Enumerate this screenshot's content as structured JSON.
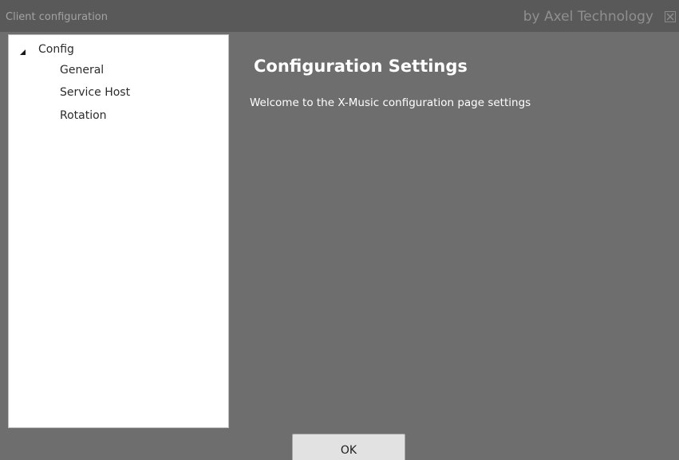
{
  "window": {
    "title": "Client configuration",
    "brand": "by Axel Technology",
    "close_icon": "close-icon"
  },
  "tree": {
    "root": {
      "label": "Config",
      "expanded": true,
      "expander_icon": "triangle-expanded-icon"
    },
    "children": [
      {
        "label": "General"
      },
      {
        "label": "Service Host"
      },
      {
        "label": "Rotation"
      }
    ]
  },
  "content": {
    "title": "Configuration Settings",
    "description": "Welcome to the X-Music configuration page settings"
  },
  "footer": {
    "ok_label": "OK"
  },
  "colors": {
    "titlebar": "#595959",
    "background": "#6e6e6e",
    "tree_background": "#ffffff",
    "button_background": "#e2e2e2"
  }
}
